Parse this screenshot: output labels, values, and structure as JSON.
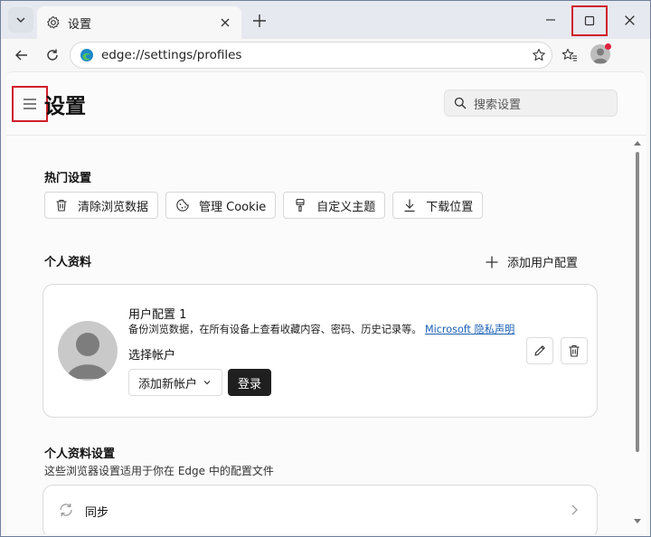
{
  "tab": {
    "title": "设置"
  },
  "address": {
    "url": "edge://settings/profiles"
  },
  "header": {
    "title": "设置",
    "search_placeholder": "搜索设置"
  },
  "popular": {
    "title": "热门设置",
    "chips": [
      {
        "label": "清除浏览数据",
        "icon": "trash-icon"
      },
      {
        "label": "管理 Cookie",
        "icon": "cookie-icon"
      },
      {
        "label": "自定义主题",
        "icon": "brush-icon"
      },
      {
        "label": "下载位置",
        "icon": "download-icon"
      }
    ]
  },
  "profiles": {
    "title": "个人资料",
    "add_label": "添加用户配置",
    "card": {
      "name": "用户配置 1",
      "desc": "备份浏览数据，在所有设备上查看收藏内容、密码、历史记录等。",
      "link_prefix": "Microsoft",
      "link_text": "隐私声明",
      "choose_label": "选择帐户",
      "add_account_label": "添加新帐户",
      "login_label": "登录"
    }
  },
  "profile_settings": {
    "title": "个人资料设置",
    "desc": "这些浏览器设置适用于你在 Edge 中的配置文件",
    "sync_label": "同步"
  }
}
